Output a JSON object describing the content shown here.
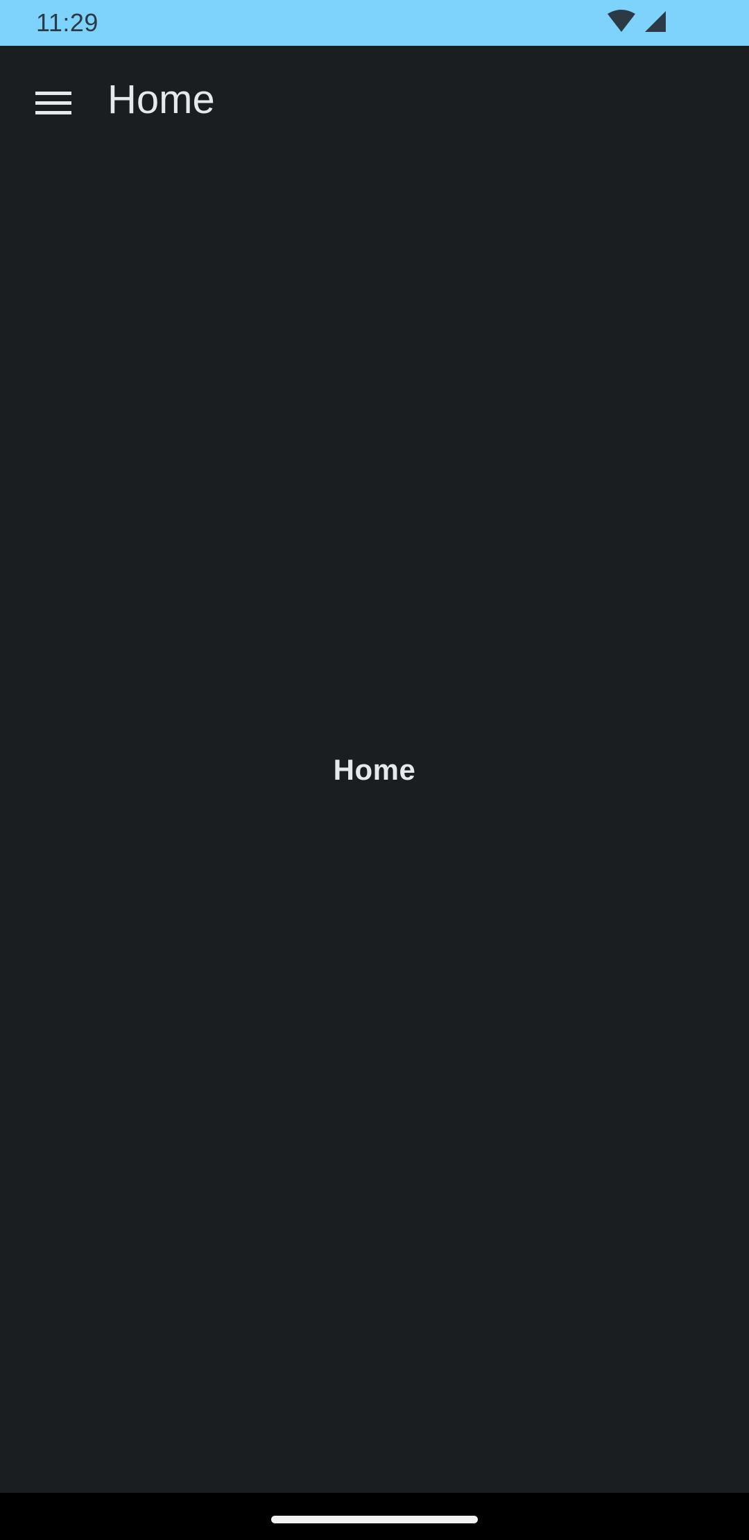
{
  "status_bar": {
    "time": "11:29",
    "icons": [
      "wifi-icon",
      "cellular-signal-icon"
    ],
    "background": "#7dd3fc"
  },
  "app_bar": {
    "title": "Home",
    "menu_icon": "hamburger-menu-icon"
  },
  "content": {
    "label": "Home"
  },
  "theme": {
    "background": "#1b1e21",
    "text": "#e6e8ea"
  }
}
